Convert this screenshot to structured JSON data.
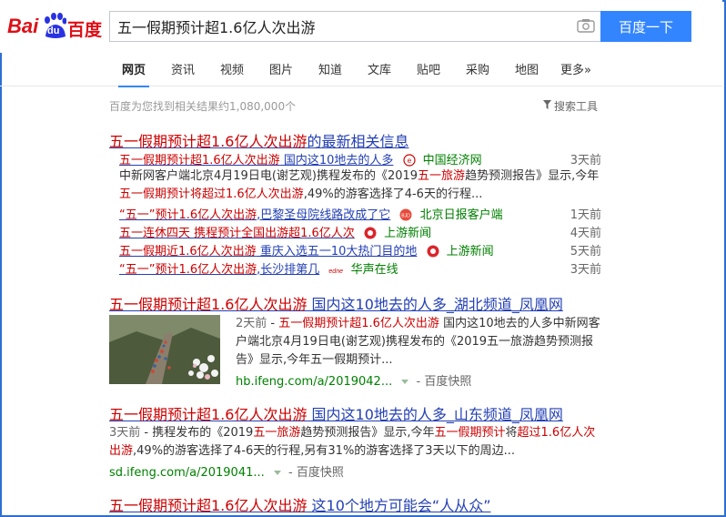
{
  "header": {
    "logo_bai": "Bai",
    "logo_du": "du",
    "logo_cn": "百度",
    "search_value": "五一假期预计超1.6亿人次出游",
    "search_button": "百度一下"
  },
  "tabs": [
    "网页",
    "资讯",
    "视频",
    "图片",
    "知道",
    "文库",
    "贴吧",
    "采购",
    "地图",
    "更多»"
  ],
  "stats": "百度为您找到相关结果约1,080,000个",
  "tools": "搜索工具",
  "results": {
    "r1": {
      "title_em": "五一假期预计超1.6亿人次出游",
      "title_rest": "的最新相关信息",
      "news": [
        {
          "em": "五一假期预计超1.6亿人次出游",
          "rest": " 国内这10地去的人多",
          "source": "中国经济网",
          "time": "3天前"
        },
        {
          "em": "“五一”预计1.6亿人次出游",
          "rest": ",巴黎圣母院线路改成了它",
          "source": "北京日报客户端",
          "time": "1天前"
        },
        {
          "em": "五一连休四天 携程预计全国出游超1.6亿人次",
          "rest": "",
          "source": "上游新闻",
          "time": "4天前"
        },
        {
          "em": "五一假期近1.6亿人次出游",
          "rest": " 重庆入选五一10大热门目的地",
          "source": "上游新闻",
          "time": "5天前"
        },
        {
          "em": "“五一”预计1.6亿人次出游",
          "rest": ",长沙排第几",
          "source": "华声在线",
          "time": "3天前"
        }
      ],
      "desc_l1_a": "中新网客户端北京4月19日电(谢艺观)携程发布的《2019",
      "desc_l1_em": "五一旅游",
      "desc_l1_b": "趋势预测报告》显示,今年",
      "desc_l2_em": "五一假期预计将超过1.6亿人次出游",
      "desc_l2_b": ",49%的游客选择了4-6天的行程..."
    },
    "r2": {
      "title_em": "五一假期预计超1.6亿人次出游",
      "title_rest": " 国内这10地去的人多_湖北频道_凤凰网",
      "date": "2天前",
      "dash": " - ",
      "desc_em": "五一假期预计超1.6亿人次出游",
      "desc_rest": " 国内这10地去的人多中新网客户端北京4月19日电(谢艺观)携程发布的《2019五一旅游趋势预测报告》显示,今年五一假期预计...",
      "url": "hb.ifeng.com/a/2019042...",
      "snapshot": "百度快照"
    },
    "r3": {
      "title_em": "五一假期预计超1.6亿人次出游",
      "title_rest": " 国内这10地去的人多_山东频道_凤凰网",
      "date": "3天前",
      "d_a": " - 携程发布的《2019",
      "d_em1": "五一旅游",
      "d_b": "趋势预测报告》显示,今年",
      "d_em2": "五一假期预计",
      "d_c": "将",
      "d_em3": "超过1.6亿人次出游",
      "d_d": ",49%的游客选择了4-6天的行程,另有31%的游客选择了3天以下的周边...",
      "url": "sd.ifeng.com/a/2019041...",
      "snapshot": "百度快照"
    },
    "r4": {
      "title_em": "五一假期预计超1.6亿人次出游",
      "title_rest": " 这10个地方可能会“人从众”"
    }
  },
  "colors": {
    "brand_blue": "#3385ff",
    "link": "#2440b3",
    "highlight": "#c00000",
    "source_green": "#008000",
    "logo_red": "#de0f17",
    "logo_blue": "#2932e1"
  }
}
